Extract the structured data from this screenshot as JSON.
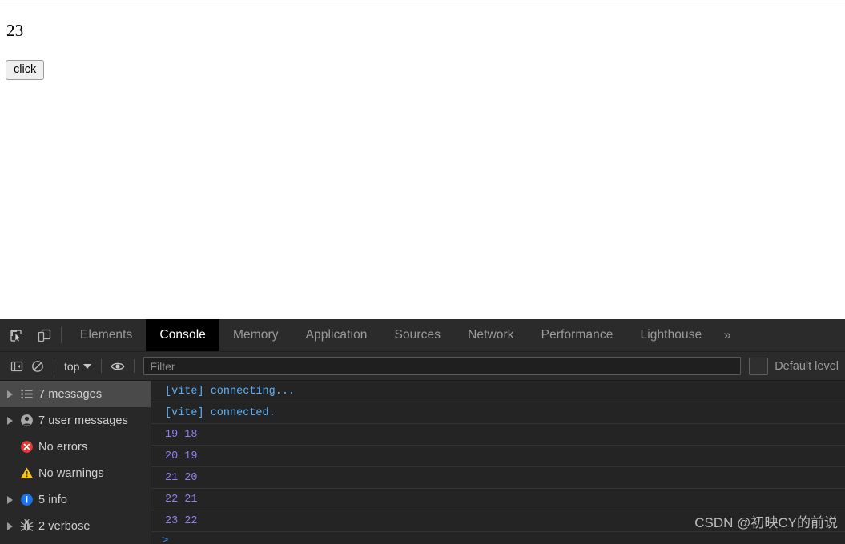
{
  "page": {
    "counter_value": "23",
    "click_button_label": "click"
  },
  "devtools": {
    "toolbar_icons": [
      {
        "name": "inspect-element-icon",
        "title": "Inspect element"
      },
      {
        "name": "device-toolbar-icon",
        "title": "Toggle device toolbar"
      }
    ],
    "tabs": [
      {
        "label": "Elements",
        "selected": false
      },
      {
        "label": "Console",
        "selected": true
      },
      {
        "label": "Memory",
        "selected": false
      },
      {
        "label": "Application",
        "selected": false
      },
      {
        "label": "Sources",
        "selected": false
      },
      {
        "label": "Network",
        "selected": false
      },
      {
        "label": "Performance",
        "selected": false
      },
      {
        "label": "Lighthouse",
        "selected": false
      }
    ],
    "more_tabs_label": "»",
    "filterbar": {
      "sidebar_toggle_name": "show-console-sidebar-icon",
      "clear_console_name": "clear-console-icon",
      "context_label": "top",
      "eye_name": "live-expression-icon",
      "filter_placeholder": "Filter",
      "filter_value": "",
      "level_label": "Default level"
    },
    "sidebar": [
      {
        "label": "7 messages",
        "icon": "list-icon",
        "has_arrow": true,
        "selected": true
      },
      {
        "label": "7 user messages",
        "icon": "user-icon",
        "has_arrow": true,
        "selected": false
      },
      {
        "label": "No errors",
        "icon": "error-icon",
        "has_arrow": false,
        "selected": false
      },
      {
        "label": "No warnings",
        "icon": "warning-icon",
        "has_arrow": false,
        "selected": false
      },
      {
        "label": "5 info",
        "icon": "info-icon",
        "has_arrow": true,
        "selected": false
      },
      {
        "label": "2 verbose",
        "icon": "bug-icon",
        "has_arrow": true,
        "selected": false
      }
    ],
    "messages": [
      {
        "text": "[vite] connecting...",
        "kind": "vite"
      },
      {
        "text": "[vite] connected.",
        "kind": "vite"
      },
      {
        "text": "19 18",
        "kind": "number"
      },
      {
        "text": "20 19",
        "kind": "number"
      },
      {
        "text": "21 20",
        "kind": "number"
      },
      {
        "text": "22 21",
        "kind": "number"
      },
      {
        "text": "23 22",
        "kind": "number"
      }
    ],
    "prompt_symbol": ">",
    "watermark": "CSDN @初映CY的前说"
  },
  "colors": {
    "tabbar_bg": "#2b2b2b",
    "selected_tab_bg": "#000000",
    "console_bg": "#242424",
    "sidebar_bg": "#282828",
    "sidebar_selected_bg": "#4a4a4a",
    "vite_text": "#5db0f7",
    "number_text": "#8f7ff0",
    "error_red": "#e53935",
    "warning_yellow": "#f5c518",
    "info_blue": "#1a73e8",
    "prompt_blue": "#3b87f0"
  }
}
